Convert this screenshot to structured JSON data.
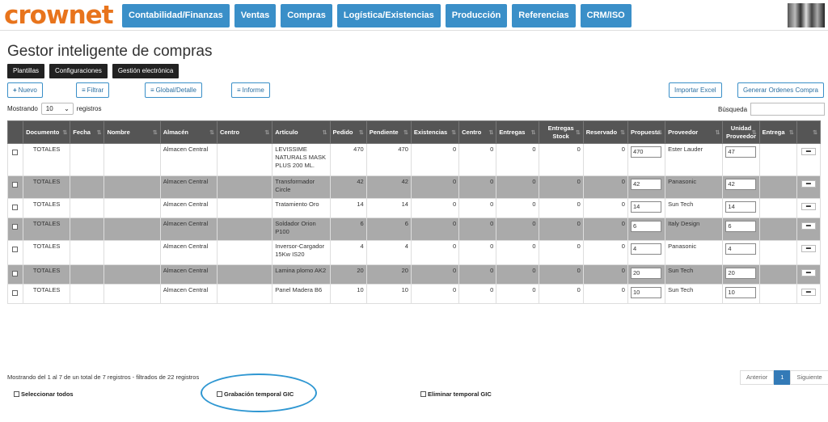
{
  "brand": {
    "logo_text": "crownet",
    "accent": "#3a8fc8",
    "logo_color": "#e8741c"
  },
  "nav": [
    "Contabilidad/Finanzas",
    "Ventas",
    "Compras",
    "Logística/Existencias",
    "Producción",
    "Referencias",
    "CRM/ISO"
  ],
  "page": {
    "title": "Gestor inteligente de compras"
  },
  "tabs": [
    "Plantillas",
    "Configuraciones",
    "Gestión electrónica"
  ],
  "toolbar": {
    "nuevo": "Nuevo",
    "filtrar": "Filtrar",
    "global": "Global/Detalle",
    "informe": "Informe",
    "importar": "Importar Excel",
    "generar": "Generar Ordenes Compra"
  },
  "entries": {
    "prefix": "Mostrando",
    "value": "10",
    "suffix": "registros"
  },
  "search": {
    "label": "Búsqueda"
  },
  "columns": [
    "",
    "Documento",
    "Fecha",
    "Nombre",
    "Almacén",
    "Centro",
    "Artículo",
    "Pedido",
    "Pendiente",
    "Existencias",
    "Centro",
    "Entregas",
    "Entregas Stock",
    "Reservado",
    "Propuesta",
    "Proveedor",
    "Unidad Proveedor",
    "Entrega",
    ""
  ],
  "rows": [
    {
      "doc": "TOTALES",
      "almacen": "Almacen Central",
      "articulo": "LEVISSIME NATURALS MASK PLUS 200 ML.",
      "pedido": "470",
      "pendiente": "470",
      "existencias": "0",
      "centro": "0",
      "entregas": "0",
      "stock": "0",
      "reservado": "0",
      "propuesta": "470",
      "proveedor": "Ester Lauder",
      "unidad": "47"
    },
    {
      "doc": "TOTALES",
      "almacen": "Almacen Central",
      "articulo": "Transformador Circle",
      "pedido": "42",
      "pendiente": "42",
      "existencias": "0",
      "centro": "0",
      "entregas": "0",
      "stock": "0",
      "reservado": "0",
      "propuesta": "42",
      "proveedor": "Panasonic",
      "unidad": "42"
    },
    {
      "doc": "TOTALES",
      "almacen": "Almacen Central",
      "articulo": "Tratamiento Oro",
      "pedido": "14",
      "pendiente": "14",
      "existencias": "0",
      "centro": "0",
      "entregas": "0",
      "stock": "0",
      "reservado": "0",
      "propuesta": "14",
      "proveedor": "Sun Tech",
      "unidad": "14"
    },
    {
      "doc": "TOTALES",
      "almacen": "Almacen Central",
      "articulo": "Soldador Orion P100",
      "pedido": "6",
      "pendiente": "6",
      "existencias": "0",
      "centro": "0",
      "entregas": "0",
      "stock": "0",
      "reservado": "0",
      "propuesta": "6",
      "proveedor": "Italy Design",
      "unidad": "6"
    },
    {
      "doc": "TOTALES",
      "almacen": "Almacen Central",
      "articulo": "Inversor-Cargador 15Kw IS20",
      "pedido": "4",
      "pendiente": "4",
      "existencias": "0",
      "centro": "0",
      "entregas": "0",
      "stock": "0",
      "reservado": "0",
      "propuesta": "4",
      "proveedor": "Panasonic",
      "unidad": "4"
    },
    {
      "doc": "TOTALES",
      "almacen": "Almacen Central",
      "articulo": "Lamina plomo AK2",
      "pedido": "20",
      "pendiente": "20",
      "existencias": "0",
      "centro": "0",
      "entregas": "0",
      "stock": "0",
      "reservado": "0",
      "propuesta": "20",
      "proveedor": "Sun Tech",
      "unidad": "20"
    },
    {
      "doc": "TOTALES",
      "almacen": "Almacen Central",
      "articulo": "Panel Madera B6",
      "pedido": "10",
      "pendiente": "10",
      "existencias": "0",
      "centro": "0",
      "entregas": "0",
      "stock": "0",
      "reservado": "0",
      "propuesta": "10",
      "proveedor": "Sun Tech",
      "unidad": "10"
    }
  ],
  "footer": {
    "info": "Mostrando del 1 al 7 de un total de 7 registros - filtrados de 22 registros",
    "prev": "Anterior",
    "page": "1",
    "next": "Siguiente",
    "select_all": "Seleccionar todos",
    "grabacion": "Grabación temporal GIC",
    "eliminar": "Eliminar temporal GIC"
  }
}
